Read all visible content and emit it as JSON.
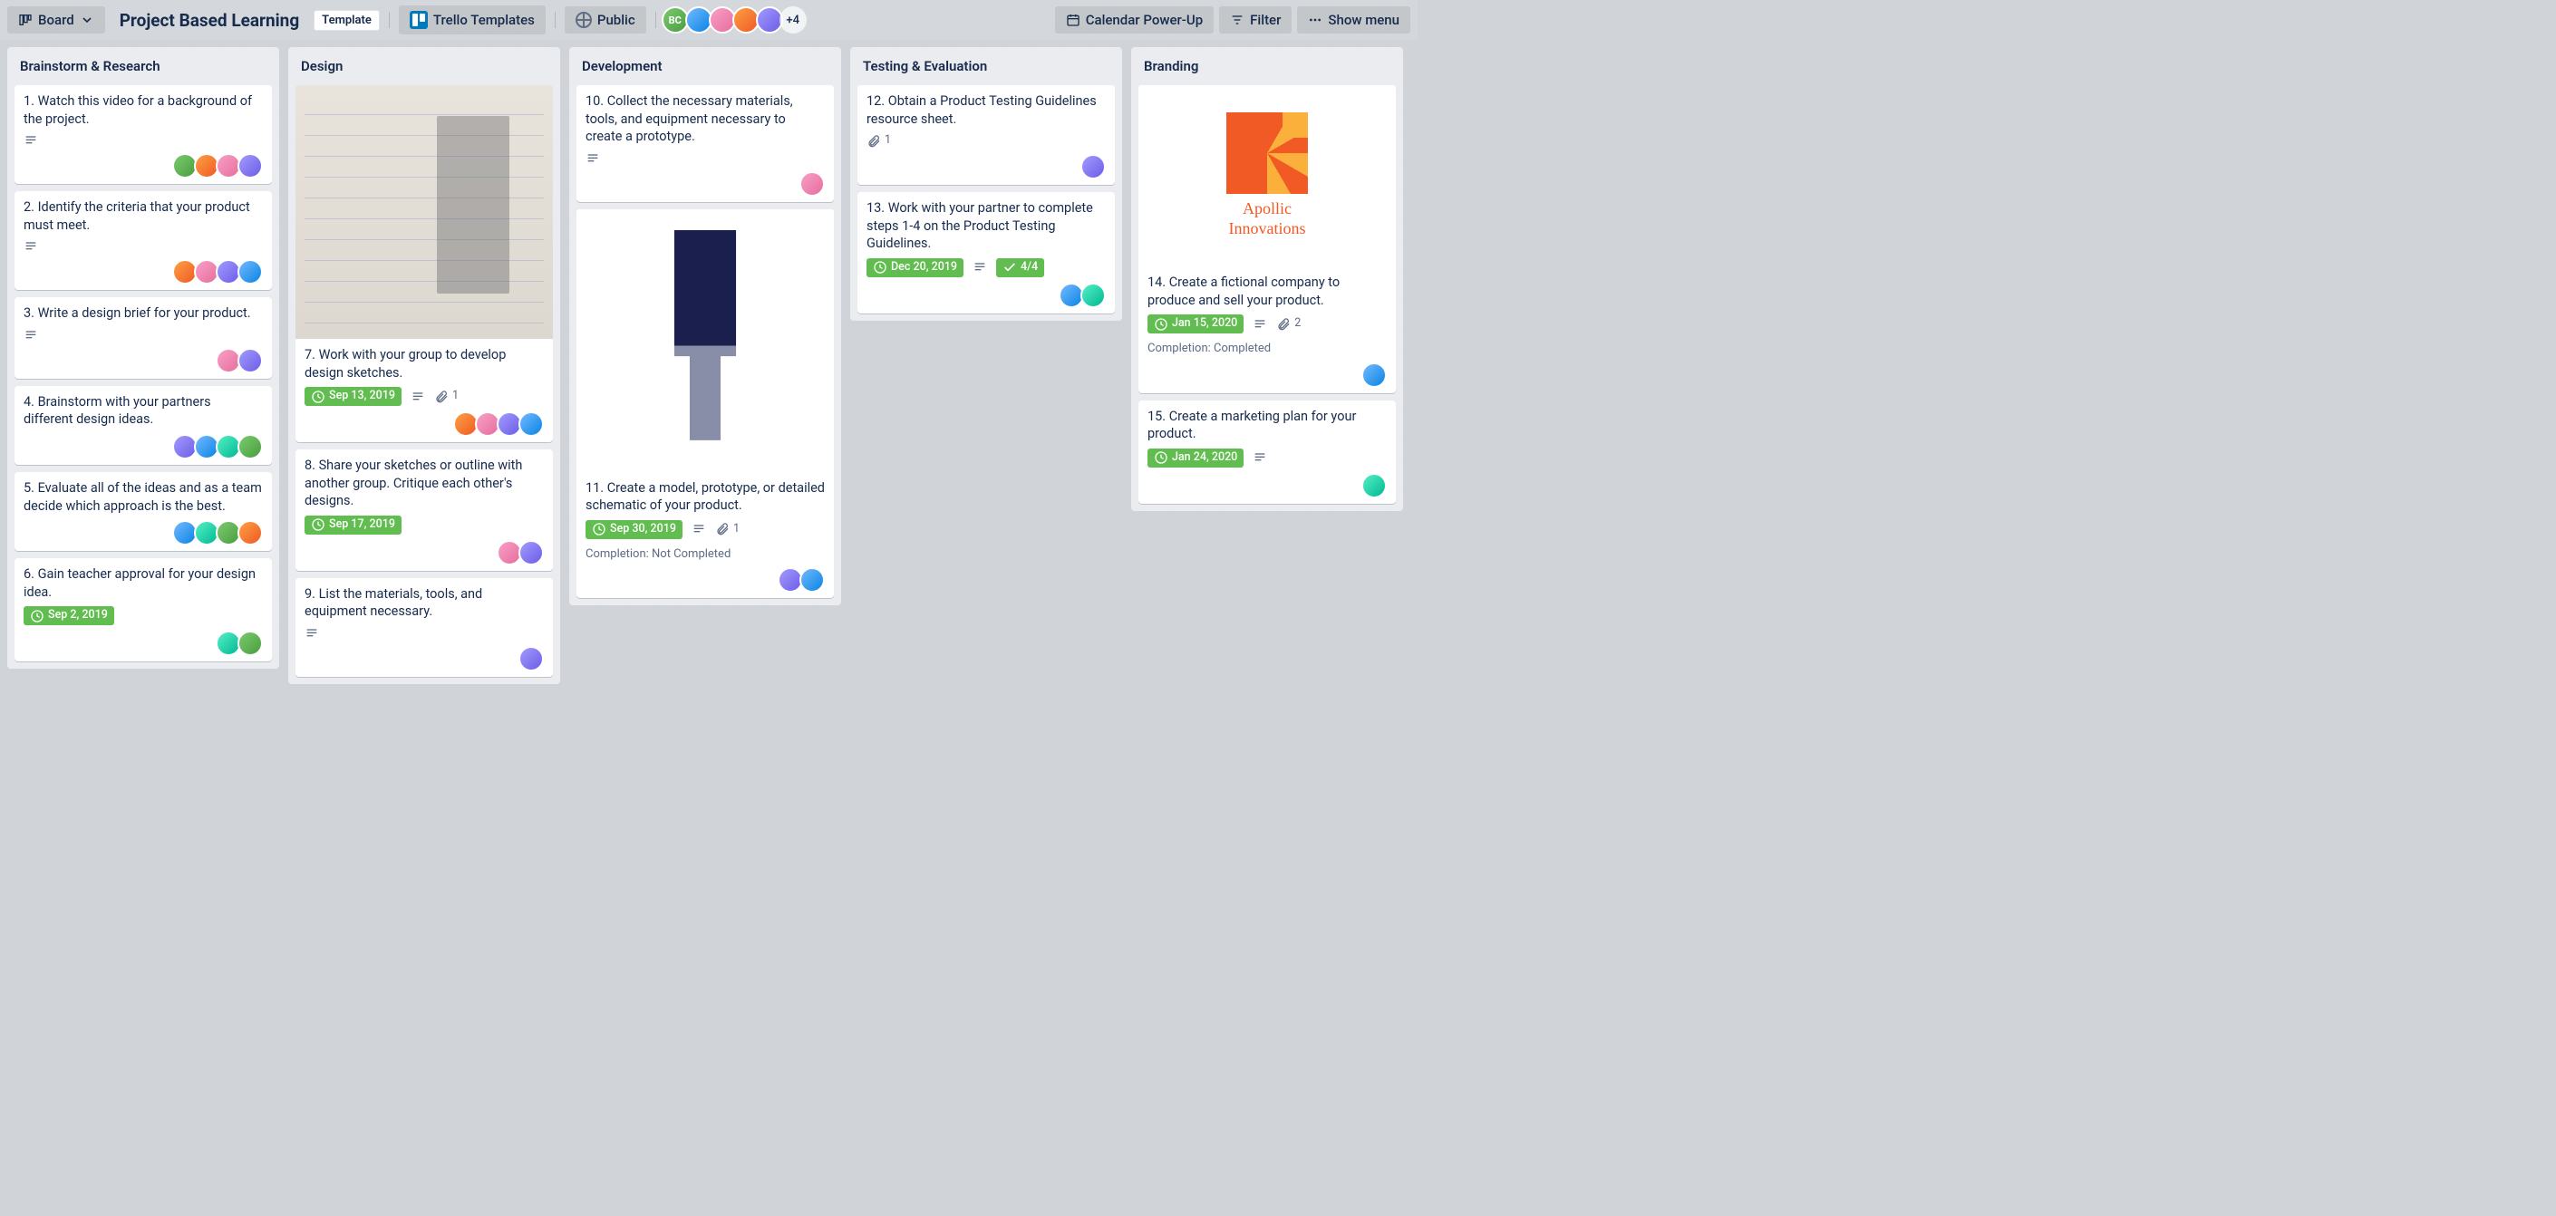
{
  "header": {
    "view_label": "Board",
    "title": "Project Based Learning",
    "template_label": "Template",
    "team_name": "Trello Templates",
    "visibility": "Public",
    "extra_members": "+4",
    "calendar": "Calendar Power-Up",
    "filter": "Filter",
    "menu": "Show menu"
  },
  "lists": [
    {
      "name": "Brainstorm & Research",
      "cards": [
        {
          "title": "1. Watch this video for a background of the project.",
          "desc": true,
          "members": 4
        },
        {
          "title": "2. Identify the criteria that your product must meet.",
          "desc": true,
          "members": 4
        },
        {
          "title": "3. Write a design brief for your product.",
          "desc": true,
          "members": 2
        },
        {
          "title": "4. Brainstorm with your partners different design ideas.",
          "members": 4
        },
        {
          "title": "5. Evaluate all of the ideas and as a team decide which approach is the best.",
          "members": 4
        },
        {
          "title": "6. Gain teacher approval for your design idea.",
          "date": "Sep 2, 2019",
          "members": 2
        }
      ]
    },
    {
      "name": "Design",
      "cards": [
        {
          "title": "7. Work with your group to develop design sketches.",
          "cover": "sketch",
          "date": "Sep 13, 2019",
          "desc": true,
          "attach": "1",
          "members": 4
        },
        {
          "title": "8. Share your sketches or outline with another group. Critique each other's designs.",
          "date": "Sep 17, 2019",
          "members": 2
        },
        {
          "title": "9. List the materials, tools, and equipment necessary.",
          "desc": true,
          "members": 1
        }
      ]
    },
    {
      "name": "Development",
      "cards": [
        {
          "title": "10. Collect the necessary materials, tools, and equipment necessary to create a prototype.",
          "desc": true,
          "members": 1
        },
        {
          "title": "11. Create a model, prototype, or detailed schematic of your product.",
          "cover": "diagram",
          "date": "Sep 30, 2019",
          "desc": true,
          "attach": "1",
          "completion": "Completion: Not Completed",
          "members": 2
        }
      ]
    },
    {
      "name": "Testing & Evaluation",
      "cards": [
        {
          "title": "12. Obtain a Product Testing Guidelines resource sheet.",
          "attach": "1",
          "members": 1
        },
        {
          "title": "13. Work with your partner to complete steps 1-4 on the Product Testing Guidelines.",
          "date": "Dec 20, 2019",
          "desc": true,
          "checklist": "4/4",
          "members": 2
        }
      ]
    },
    {
      "name": "Branding",
      "cards": [
        {
          "title": "14. Create a fictional company to produce and sell your product.",
          "cover": "logo",
          "logo_text": "Apollic\nInnovations",
          "date": "Jan 15, 2020",
          "desc": true,
          "attach": "2",
          "completion": "Completion: Completed",
          "members": 1
        },
        {
          "title": "15. Create a marketing plan for your product.",
          "date": "Jan 24, 2020",
          "desc": true,
          "members": 1
        }
      ]
    }
  ]
}
